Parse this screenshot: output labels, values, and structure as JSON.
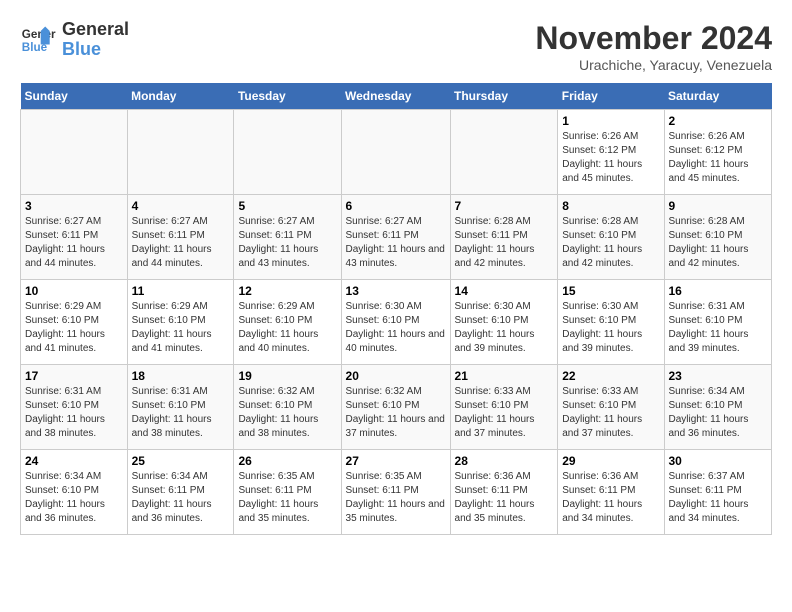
{
  "logo": {
    "line1": "General",
    "line2": "Blue"
  },
  "title": "November 2024",
  "subtitle": "Urachiche, Yaracuy, Venezuela",
  "headers": [
    "Sunday",
    "Monday",
    "Tuesday",
    "Wednesday",
    "Thursday",
    "Friday",
    "Saturday"
  ],
  "weeks": [
    [
      {
        "day": "",
        "info": ""
      },
      {
        "day": "",
        "info": ""
      },
      {
        "day": "",
        "info": ""
      },
      {
        "day": "",
        "info": ""
      },
      {
        "day": "",
        "info": ""
      },
      {
        "day": "1",
        "info": "Sunrise: 6:26 AM\nSunset: 6:12 PM\nDaylight: 11 hours and 45 minutes."
      },
      {
        "day": "2",
        "info": "Sunrise: 6:26 AM\nSunset: 6:12 PM\nDaylight: 11 hours and 45 minutes."
      }
    ],
    [
      {
        "day": "3",
        "info": "Sunrise: 6:27 AM\nSunset: 6:11 PM\nDaylight: 11 hours and 44 minutes."
      },
      {
        "day": "4",
        "info": "Sunrise: 6:27 AM\nSunset: 6:11 PM\nDaylight: 11 hours and 44 minutes."
      },
      {
        "day": "5",
        "info": "Sunrise: 6:27 AM\nSunset: 6:11 PM\nDaylight: 11 hours and 43 minutes."
      },
      {
        "day": "6",
        "info": "Sunrise: 6:27 AM\nSunset: 6:11 PM\nDaylight: 11 hours and 43 minutes."
      },
      {
        "day": "7",
        "info": "Sunrise: 6:28 AM\nSunset: 6:11 PM\nDaylight: 11 hours and 42 minutes."
      },
      {
        "day": "8",
        "info": "Sunrise: 6:28 AM\nSunset: 6:10 PM\nDaylight: 11 hours and 42 minutes."
      },
      {
        "day": "9",
        "info": "Sunrise: 6:28 AM\nSunset: 6:10 PM\nDaylight: 11 hours and 42 minutes."
      }
    ],
    [
      {
        "day": "10",
        "info": "Sunrise: 6:29 AM\nSunset: 6:10 PM\nDaylight: 11 hours and 41 minutes."
      },
      {
        "day": "11",
        "info": "Sunrise: 6:29 AM\nSunset: 6:10 PM\nDaylight: 11 hours and 41 minutes."
      },
      {
        "day": "12",
        "info": "Sunrise: 6:29 AM\nSunset: 6:10 PM\nDaylight: 11 hours and 40 minutes."
      },
      {
        "day": "13",
        "info": "Sunrise: 6:30 AM\nSunset: 6:10 PM\nDaylight: 11 hours and 40 minutes."
      },
      {
        "day": "14",
        "info": "Sunrise: 6:30 AM\nSunset: 6:10 PM\nDaylight: 11 hours and 39 minutes."
      },
      {
        "day": "15",
        "info": "Sunrise: 6:30 AM\nSunset: 6:10 PM\nDaylight: 11 hours and 39 minutes."
      },
      {
        "day": "16",
        "info": "Sunrise: 6:31 AM\nSunset: 6:10 PM\nDaylight: 11 hours and 39 minutes."
      }
    ],
    [
      {
        "day": "17",
        "info": "Sunrise: 6:31 AM\nSunset: 6:10 PM\nDaylight: 11 hours and 38 minutes."
      },
      {
        "day": "18",
        "info": "Sunrise: 6:31 AM\nSunset: 6:10 PM\nDaylight: 11 hours and 38 minutes."
      },
      {
        "day": "19",
        "info": "Sunrise: 6:32 AM\nSunset: 6:10 PM\nDaylight: 11 hours and 38 minutes."
      },
      {
        "day": "20",
        "info": "Sunrise: 6:32 AM\nSunset: 6:10 PM\nDaylight: 11 hours and 37 minutes."
      },
      {
        "day": "21",
        "info": "Sunrise: 6:33 AM\nSunset: 6:10 PM\nDaylight: 11 hours and 37 minutes."
      },
      {
        "day": "22",
        "info": "Sunrise: 6:33 AM\nSunset: 6:10 PM\nDaylight: 11 hours and 37 minutes."
      },
      {
        "day": "23",
        "info": "Sunrise: 6:34 AM\nSunset: 6:10 PM\nDaylight: 11 hours and 36 minutes."
      }
    ],
    [
      {
        "day": "24",
        "info": "Sunrise: 6:34 AM\nSunset: 6:10 PM\nDaylight: 11 hours and 36 minutes."
      },
      {
        "day": "25",
        "info": "Sunrise: 6:34 AM\nSunset: 6:11 PM\nDaylight: 11 hours and 36 minutes."
      },
      {
        "day": "26",
        "info": "Sunrise: 6:35 AM\nSunset: 6:11 PM\nDaylight: 11 hours and 35 minutes."
      },
      {
        "day": "27",
        "info": "Sunrise: 6:35 AM\nSunset: 6:11 PM\nDaylight: 11 hours and 35 minutes."
      },
      {
        "day": "28",
        "info": "Sunrise: 6:36 AM\nSunset: 6:11 PM\nDaylight: 11 hours and 35 minutes."
      },
      {
        "day": "29",
        "info": "Sunrise: 6:36 AM\nSunset: 6:11 PM\nDaylight: 11 hours and 34 minutes."
      },
      {
        "day": "30",
        "info": "Sunrise: 6:37 AM\nSunset: 6:11 PM\nDaylight: 11 hours and 34 minutes."
      }
    ]
  ]
}
